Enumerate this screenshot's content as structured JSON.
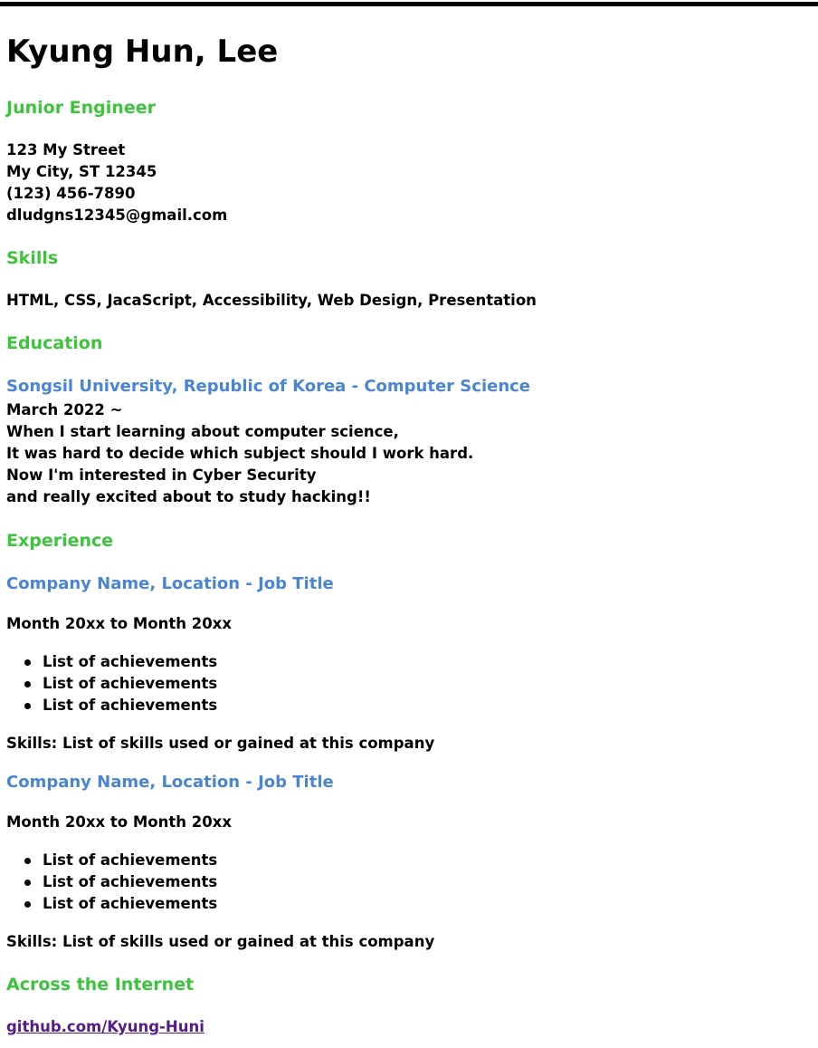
{
  "header": {
    "name": "Kyung Hun, Lee",
    "title": "Junior Engineer"
  },
  "contact": {
    "street": "123 My Street",
    "city": "My City, ST 12345",
    "phone": "(123) 456-7890",
    "email": "dludgns12345@gmail.com"
  },
  "skills": {
    "heading": "Skills",
    "text": "HTML, CSS, JacaScript, Accessibility, Web Design, Presentation"
  },
  "education": {
    "heading": "Education",
    "school": "Songsil University, Republic of Korea - Computer Science",
    "date": "March 2022 ~",
    "lines": [
      "When I start learning about computer science,",
      "It was hard to decide which subject should I work hard.",
      "Now I'm interested in Cyber Security",
      "and really excited about to study hacking!!"
    ]
  },
  "experience": {
    "heading": "Experience",
    "jobs": [
      {
        "title": "Company Name, Location - Job Title",
        "dates": "Month 20xx to Month 20xx",
        "achievements": [
          "List of achievements",
          "List of achievements",
          "List of achievements"
        ],
        "skills": "Skills: List of skills used or gained at this company"
      },
      {
        "title": "Company Name, Location - Job Title",
        "dates": "Month 20xx to Month 20xx",
        "achievements": [
          "List of achievements",
          "List of achievements",
          "List of achievements"
        ],
        "skills": "Skills: List of skills used or gained at this company"
      }
    ]
  },
  "internet": {
    "heading": "Across the Internet",
    "link": "github.com/Kyung-Huni"
  },
  "colors": {
    "section_heading": "#3cc43c",
    "sub_heading": "#4a85d3",
    "visited_link": "#551a8b"
  }
}
